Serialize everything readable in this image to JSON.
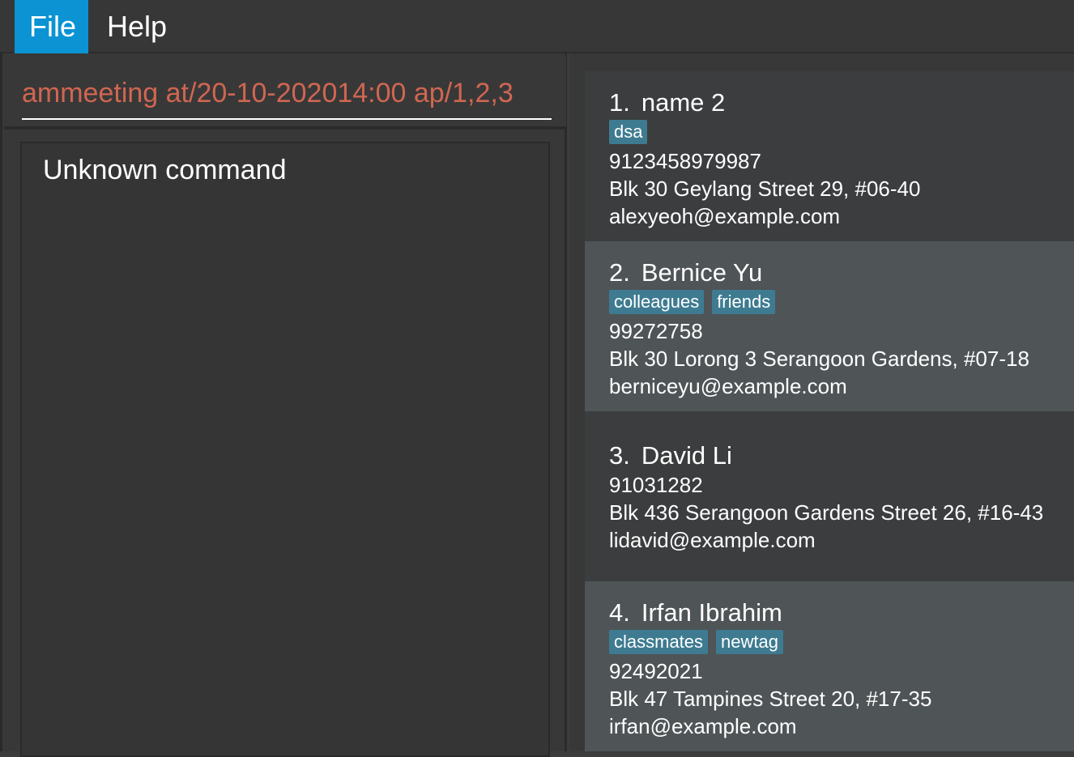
{
  "menu": {
    "items": [
      {
        "label": "File",
        "active": true
      },
      {
        "label": "Help",
        "active": false
      }
    ]
  },
  "command": {
    "value": "ammeeting at/20-10-202014:00 ap/1,2,3"
  },
  "result": {
    "text": "Unknown command"
  },
  "persons": [
    {
      "index": "1.",
      "name": "name 2",
      "tags": [
        "dsa"
      ],
      "phone": "9123458979987",
      "address": "Blk 30 Geylang Street 29, #06-40",
      "email": "alexyeoh@example.com"
    },
    {
      "index": "2.",
      "name": "Bernice Yu",
      "tags": [
        "colleagues",
        "friends"
      ],
      "phone": "99272758",
      "address": "Blk 30 Lorong 3 Serangoon Gardens, #07-18",
      "email": "berniceyu@example.com"
    },
    {
      "index": "3.",
      "name": "David Li",
      "tags": [],
      "phone": "91031282",
      "address": "Blk 436 Serangoon Gardens Street 26, #16-43",
      "email": "lidavid@example.com"
    },
    {
      "index": "4.",
      "name": "Irfan Ibrahim",
      "tags": [
        "classmates",
        "newtag"
      ],
      "phone": "92492021",
      "address": "Blk 47 Tampines Street 20, #17-35",
      "email": "irfan@example.com"
    }
  ],
  "colors": {
    "menu_active": "#0b93d3",
    "command_text": "#d06651",
    "tag_bg": "#3e7b91"
  }
}
